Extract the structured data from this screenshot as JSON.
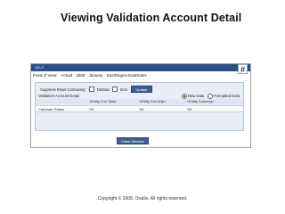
{
  "slide": {
    "title": "Viewing Validation Account Detail",
    "copyright": "Copyright © 2008, Oracle. All rights reserved."
  },
  "window": {
    "help_label": "HELP",
    "grid_icon": "hash-grid-icon"
  },
  "pov": {
    "label": "Point of View:",
    "values": [
      "Actual",
      "2008",
      "January",
      "EastRegion.EastSales"
    ]
  },
  "suppress": {
    "label": "Suppress Rows Containing:",
    "options": [
      {
        "label": "NoData",
        "checked": false
      },
      {
        "label": "Zero",
        "checked": false
      }
    ],
    "update_label": "Update"
  },
  "table": {
    "title": "Validation Account Detail",
    "view_options": [
      {
        "label": "Raw Data",
        "selected": true
      },
      {
        "label": "Formatted Data",
        "selected": false
      }
    ],
    "columns": [
      "<Entity Curr Total>",
      "<Entity Curr Adjs>",
      "<Entity Currency>"
    ],
    "rows": [
      {
        "label": "Calculate Status",
        "values": [
          "OK",
          "OK",
          "OK"
        ]
      }
    ]
  },
  "close_label": "Close Window"
}
